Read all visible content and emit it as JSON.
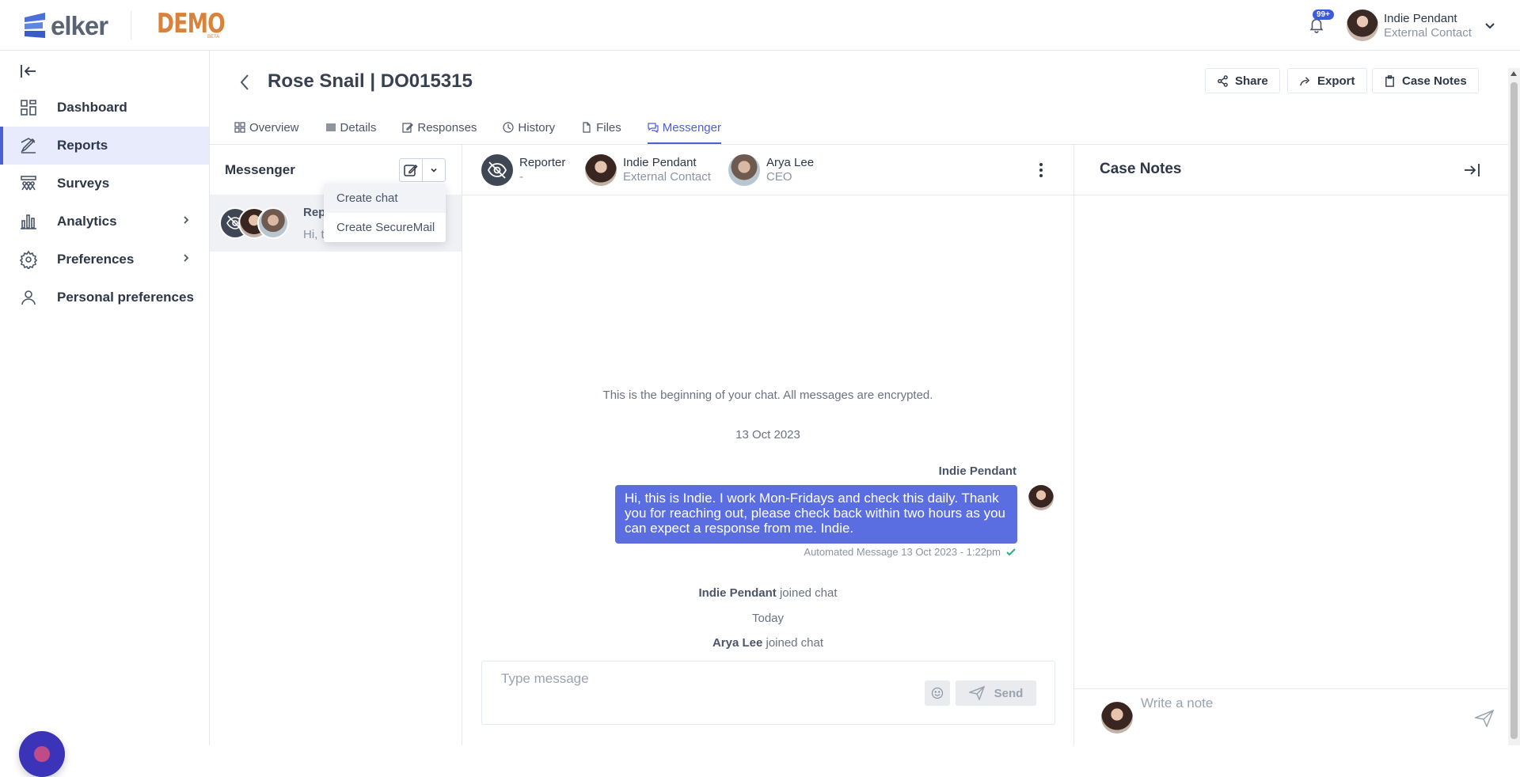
{
  "brand": {
    "logo_text": "elker",
    "demo_label": "DEMO",
    "demo_sub": "BETA",
    "accent": "#4c5fd5",
    "demo_color": "#d9823b"
  },
  "header_user": {
    "notifications_badge": "99+",
    "name": "Indie Pendant",
    "role": "External Contact"
  },
  "sidebar": {
    "items": [
      {
        "label": "Dashboard",
        "icon": "grid-icon"
      },
      {
        "label": "Reports",
        "icon": "reports-icon",
        "active": true
      },
      {
        "label": "Surveys",
        "icon": "surveys-icon"
      },
      {
        "label": "Analytics",
        "icon": "bar-chart-icon",
        "has_children": true
      },
      {
        "label": "Preferences",
        "icon": "gear-icon",
        "has_children": true
      },
      {
        "label": "Personal preferences",
        "icon": "person-icon"
      }
    ]
  },
  "page": {
    "title": "Rose Snail | DO015315",
    "actions": {
      "share": "Share",
      "export": "Export",
      "case_notes": "Case Notes"
    },
    "tabs": [
      {
        "label": "Overview",
        "icon": "overview-icon"
      },
      {
        "label": "Details",
        "icon": "list-icon"
      },
      {
        "label": "Responses",
        "icon": "edit-icon"
      },
      {
        "label": "History",
        "icon": "history-icon"
      },
      {
        "label": "Files",
        "icon": "file-icon"
      },
      {
        "label": "Messenger",
        "icon": "chat-icon",
        "active": true
      }
    ]
  },
  "messenger_list": {
    "title": "Messenger",
    "chat_item": {
      "name": "Rep",
      "preview": "Hi, t"
    },
    "dropdown": {
      "create_chat": "Create chat",
      "create_securemail": "Create SecureMail"
    }
  },
  "chat": {
    "participants": [
      {
        "name": "Reporter",
        "role": "-"
      },
      {
        "name": "Indie Pendant",
        "role": "External Contact"
      },
      {
        "name": "Arya Lee",
        "role": "CEO"
      }
    ],
    "beginning_note": "This is the beginning of your chat. All messages are encrypted.",
    "date_1": "13 Oct 2023",
    "message": {
      "sender": "Indie Pendant",
      "text": "Hi, this is Indie. I work Mon-Fridays and check this daily. Thank you for reaching out, please check back within two hours as you can expect a response from me. Indie.",
      "meta": "Automated Message 13 Oct 2023 - 1:22pm"
    },
    "joined_1": {
      "name": "Indie Pendant",
      "suffix": " joined chat"
    },
    "date_2": "Today",
    "joined_2": {
      "name": "Arya Lee",
      "suffix": " joined chat"
    },
    "input_placeholder": "Type message",
    "send_label": "Send"
  },
  "case_notes": {
    "title": "Case Notes",
    "input_placeholder": "Write a note"
  }
}
